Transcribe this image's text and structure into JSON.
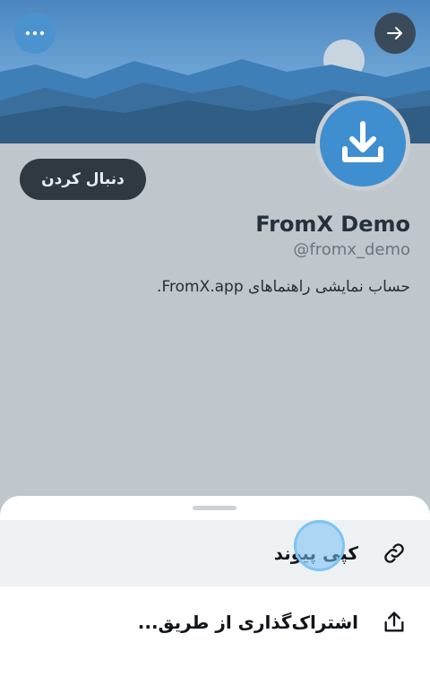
{
  "profile": {
    "display_name": "FromX Demo",
    "handle": "@fromx_demo",
    "bio": "حساب نمایشی راهنماهای FromX.app.",
    "follow_label": "دنبال کردن"
  },
  "share_sheet": {
    "items": [
      {
        "label": "کپی پیوند",
        "icon": "link-icon"
      },
      {
        "label": "اشتراک‌گذاری از طریق...",
        "icon": "share-icon"
      }
    ]
  },
  "icons": {
    "top_left": "more-horizontal-icon",
    "top_right": "arrow-right-icon",
    "avatar": "download-icon"
  },
  "colors": {
    "banner_sky": "#4e8fc8",
    "follow_button": "#2f3942",
    "avatar": "#3f8fd0",
    "selected_row": "#eef1f4"
  }
}
